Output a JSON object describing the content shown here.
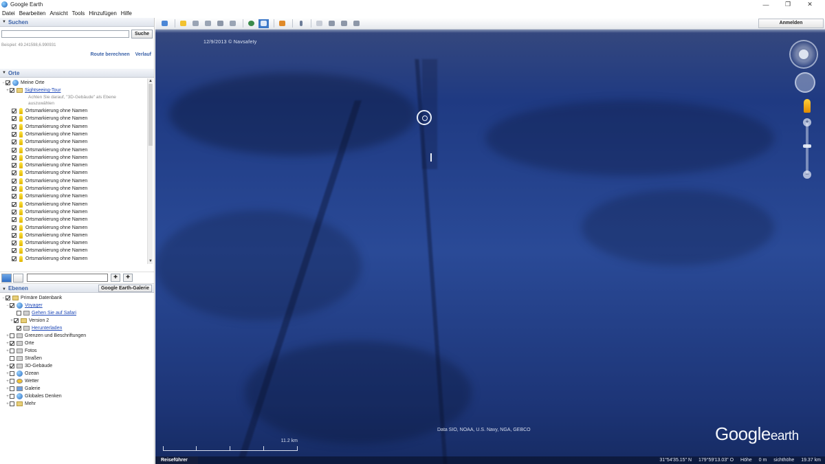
{
  "window": {
    "title": "Google Earth",
    "controls": [
      "—",
      "❐",
      "✕"
    ]
  },
  "menu": [
    "Datei",
    "Bearbeiten",
    "Ansicht",
    "Tools",
    "Hinzufügen",
    "Hilfe"
  ],
  "search": {
    "header": "Suchen",
    "button": "Suche",
    "hint": "Beispiel: 49.241598,6.990931",
    "links": [
      "Route berechnen",
      "Verlauf"
    ]
  },
  "places": {
    "header": "Orte",
    "root": "Meine Orte",
    "tour": "Sightseeing-Tour",
    "tour_note_1": "Achten Sie darauf, \"3D-Gebäude\" als Ebene",
    "tour_note_2": "auszuwählen",
    "placemarks": [
      "Ortsmarkierung ohne Namen",
      "Ortsmarkierung ohne Namen",
      "Ortsmarkierung ohne Namen",
      "Ortsmarkierung ohne Namen",
      "Ortsmarkierung ohne Namen",
      "Ortsmarkierung ohne Namen",
      "Ortsmarkierung ohne Namen",
      "Ortsmarkierung ohne Namen",
      "Ortsmarkierung ohne Namen",
      "Ortsmarkierung ohne Namen",
      "Ortsmarkierung ohne Namen",
      "Ortsmarkierung ohne Namen",
      "Ortsmarkierung ohne Namen",
      "Ortsmarkierung ohne Namen",
      "Ortsmarkierung ohne Namen",
      "Ortsmarkierung ohne Namen",
      "Ortsmarkierung ohne Namen",
      "Ortsmarkierung ohne Namen",
      "Ortsmarkierung ohne Namen",
      "Ortsmarkierung ohne Namen"
    ]
  },
  "layers": {
    "header": "Ebenen",
    "gallery_button": "Google Earth-Galerie",
    "items": {
      "primary": "Primäre Datenbank",
      "voyager": "Voyager",
      "safari": "Gehen Sie auf Safari",
      "version": "Version 2",
      "download": "Herunterladen",
      "borders": "Grenzen und Beschriftungen",
      "places": "Orte",
      "photos": "Fotos",
      "roads": "Straßen",
      "buildings": "3D-Gebäude",
      "ocean": "Ozean",
      "weather": "Wetter",
      "gallery": "Galerie",
      "global": "Globales Denken",
      "more": "Mehr"
    }
  },
  "map": {
    "signin": "Anmelden",
    "date": "12/9/2013   © Navsafety",
    "attribution": "Data SIO, NOAA, U.S. Navy, NGA, GEBCO",
    "logo_main": "Google",
    "logo_sub": "earth",
    "scale_label": "11.2 km",
    "tour_guide": "Reiseführer",
    "status": {
      "lat": "31°54'35.15\" N",
      "lon": "179°59'13.03\" O",
      "elev_label": "Höhe",
      "elev": "0 m",
      "eye_label": "sichthöhe",
      "eye": "19.37 km"
    }
  },
  "colors": {
    "ocean": "#1f3a82",
    "accent": "#3b62a8",
    "link": "#1f49b8"
  }
}
